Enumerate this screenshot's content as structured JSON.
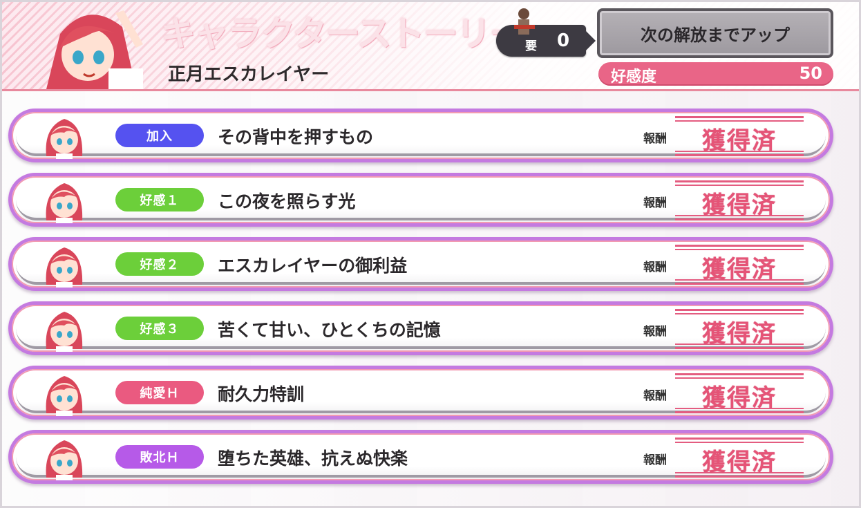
{
  "header": {
    "title": "キャラクターストーリー",
    "subtitle": "正月エスカレイヤー",
    "requirement_label": "要",
    "requirement_value": "0",
    "unlock_button_label": "次の解放までアップ",
    "affection_label": "好感度",
    "affection_value": "50"
  },
  "colors": {
    "accent_pink": "#e96587",
    "tag_join": "#5552f0",
    "tag_affection": "#6ccf3a",
    "tag_pure_love": "#ea5a80",
    "tag_defeat": "#b65ae8"
  },
  "stories": [
    {
      "tag": "加入",
      "tag_color": "#5552f0",
      "title": "その背中を押すもの",
      "reward_label": "報酬",
      "status": "獲得済"
    },
    {
      "tag": "好感１",
      "tag_color": "#6ccf3a",
      "title": "この夜を照らす光",
      "reward_label": "報酬",
      "status": "獲得済"
    },
    {
      "tag": "好感２",
      "tag_color": "#6ccf3a",
      "title": "エスカレイヤーの御利益",
      "reward_label": "報酬",
      "status": "獲得済"
    },
    {
      "tag": "好感３",
      "tag_color": "#6ccf3a",
      "title": "苦くて甘い、ひとくちの記憶",
      "reward_label": "報酬",
      "status": "獲得済"
    },
    {
      "tag": "純愛Ｈ",
      "tag_color": "#ea5a80",
      "title": "耐久力特訓",
      "reward_label": "報酬",
      "status": "獲得済"
    },
    {
      "tag": "敗北Ｈ",
      "tag_color": "#b65ae8",
      "title": "堕ちた英雄、抗えぬ快楽",
      "reward_label": "報酬",
      "status": "獲得済"
    }
  ]
}
